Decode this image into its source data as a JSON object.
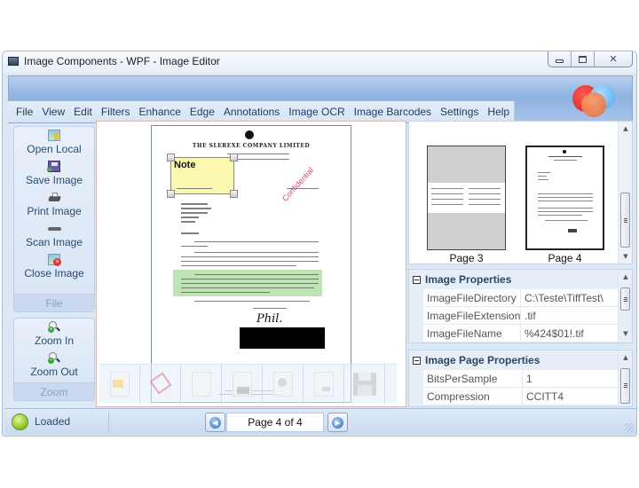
{
  "window": {
    "title": "Image Components - WPF - Image Editor",
    "controls": {
      "minimize": "minimize",
      "maximize": "maximize",
      "close": "close"
    }
  },
  "menu": {
    "items": [
      "File",
      "View",
      "Edit",
      "Filters",
      "Enhance",
      "Edge",
      "Annotations",
      "Image OCR",
      "Image Barcodes",
      "Settings",
      "Help"
    ]
  },
  "left_panel": {
    "file_group": {
      "label": "File",
      "buttons": [
        {
          "label": "Open Local",
          "icon": "open-image-icon"
        },
        {
          "label": "Save Image",
          "icon": "save-image-icon"
        },
        {
          "label": "Print Image",
          "icon": "printer-icon"
        },
        {
          "label": "Scan Image",
          "icon": "scanner-icon"
        },
        {
          "label": "Close Image",
          "icon": "close-image-icon"
        }
      ]
    },
    "zoom_group": {
      "label": "Zoom",
      "buttons": [
        {
          "label": "Zoom In",
          "icon": "zoom-in-icon"
        },
        {
          "label": "Zoom Out",
          "icon": "zoom-out-icon"
        }
      ]
    }
  },
  "document": {
    "heading": "THE SLEREXE COMPANY LIMITED",
    "annotations": {
      "note_text": "Note",
      "stamp_text": "Confidential",
      "highlight_color": "#bfe3b4",
      "redaction_color": "#000000"
    },
    "signature": "Phil."
  },
  "thumbnails": [
    {
      "caption": "Page 3",
      "selected": false
    },
    {
      "caption": "Page 4",
      "selected": true
    }
  ],
  "image_properties": {
    "title": "Image Properties",
    "rows": [
      {
        "name": "ImageFileDirectory",
        "value": "C:\\Teste\\TiffTest\\"
      },
      {
        "name": "ImageFileExtension",
        "value": ".tif"
      },
      {
        "name": "ImageFileName",
        "value": "%424$01!.tif"
      }
    ]
  },
  "image_page_properties": {
    "title": "Image Page Properties",
    "rows": [
      {
        "name": "BitsPerSample",
        "value": "1"
      },
      {
        "name": "Compression",
        "value": "CCITT4"
      }
    ]
  },
  "status": {
    "text": "Loaded",
    "led_color": "#94c92a",
    "page_display": "Page 4 of 4"
  }
}
